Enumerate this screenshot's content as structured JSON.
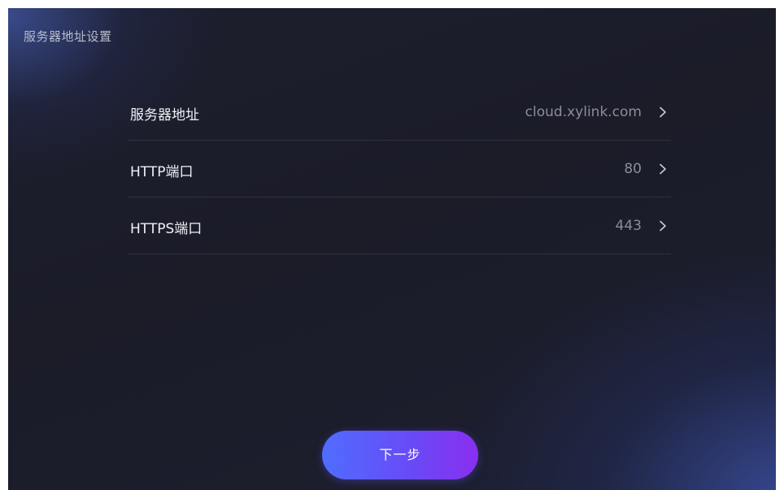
{
  "page": {
    "title": "服务器地址设置"
  },
  "settings": {
    "items": [
      {
        "label": "服务器地址",
        "value": "cloud.xylink.com"
      },
      {
        "label": "HTTP端口",
        "value": "80"
      },
      {
        "label": "HTTPS端口",
        "value": "443"
      }
    ]
  },
  "footer": {
    "next_label": "下一步"
  },
  "icons": {
    "row_action": "chevron-right-icon"
  },
  "colors": {
    "background": "#1b1c28",
    "label_text": "#eef0f6",
    "value_text": "#8a8d9c",
    "button_gradient_start": "#4f6dff",
    "button_gradient_end": "#8a2fef"
  }
}
